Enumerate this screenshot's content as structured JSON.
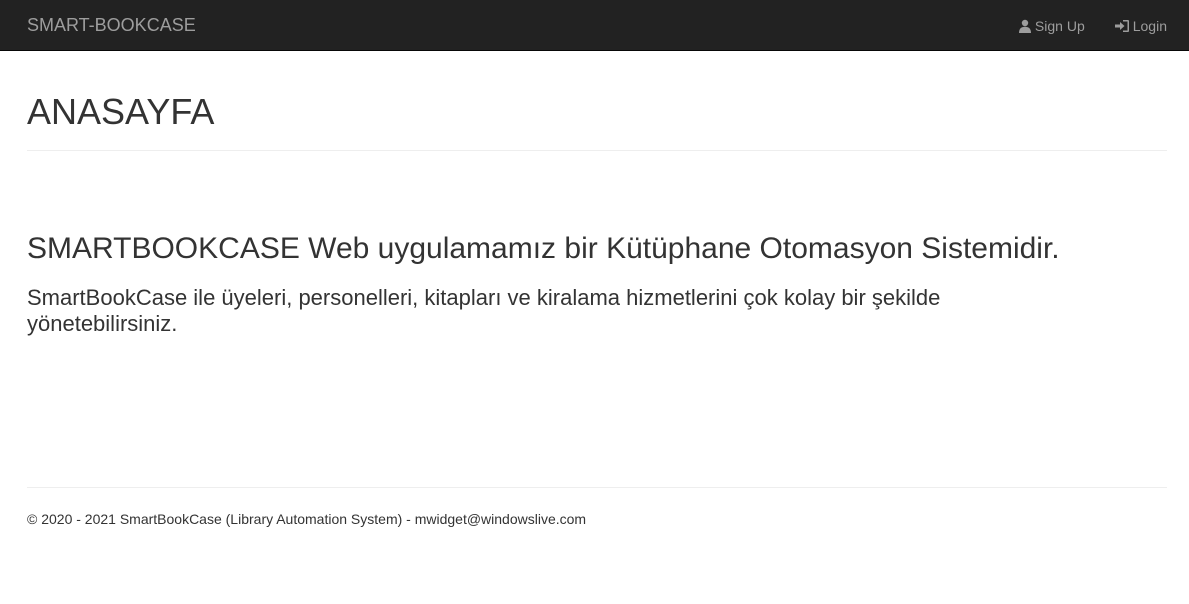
{
  "navbar": {
    "brand": "SMART-BOOKCASE",
    "links": [
      {
        "label": "Sign Up",
        "icon": "user-icon"
      },
      {
        "label": "Login",
        "icon": "login-icon"
      }
    ]
  },
  "main": {
    "page_title": "ANASAYFA",
    "heading": "SMARTBOOKCASE Web uygulamamız bir Kütüphane Otomasyon Sistemidir.",
    "description": "SmartBookCase ile üyeleri, personelleri, kitapları ve kiralama hizmetlerini çok kolay bir şekilde yönetebilirsiniz."
  },
  "footer": {
    "text": "© 2020 - 2021 SmartBookCase (Library Automation System) - mwidget@windowslive.com"
  },
  "colors": {
    "navbar_bg": "#222222",
    "nav_text": "#9d9d9d",
    "body_text": "#333333",
    "divider": "#eeeeee"
  }
}
